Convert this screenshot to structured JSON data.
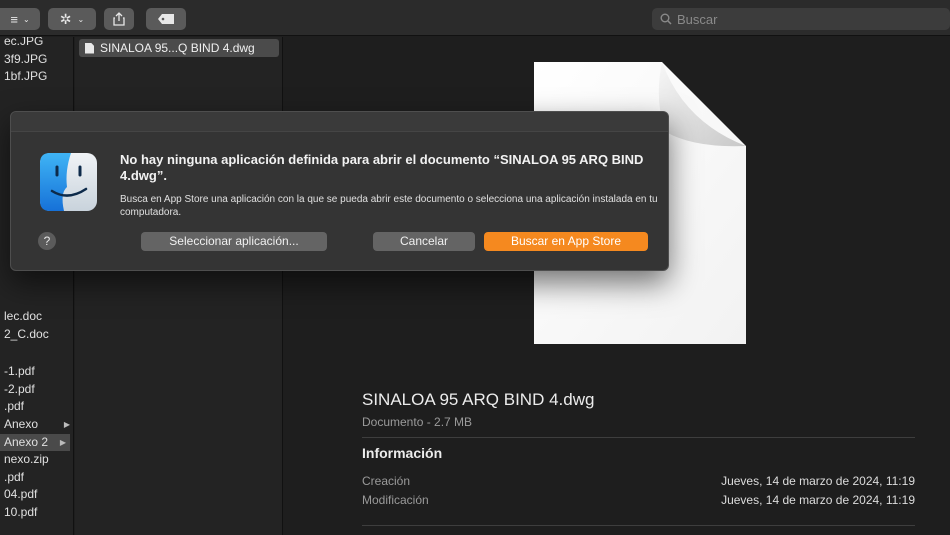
{
  "toolbar": {
    "view_icon": "list-view-icon",
    "action_icon": "gear-icon",
    "share_icon": "share-icon",
    "tag_icon": "tag-icon",
    "search_placeholder": "Buscar"
  },
  "column1": {
    "items": [
      {
        "label": "ec.JPG",
        "selected": false
      },
      {
        "label": "3f9.JPG",
        "selected": false
      },
      {
        "label": "1bf.JPG",
        "selected": false
      },
      {
        "label": "lec.doc",
        "selected": false
      },
      {
        "label": "2_C.doc",
        "selected": false
      },
      {
        "label": "-1.pdf",
        "selected": false
      },
      {
        "label": "-2.pdf",
        "selected": false
      },
      {
        "label": ".pdf",
        "selected": false
      },
      {
        "label": "Anexo",
        "selected": false,
        "folder": true
      },
      {
        "label": "Anexo 2",
        "selected": true,
        "folder": true
      },
      {
        "label": "nexo.zip",
        "selected": false
      },
      {
        "label": ".pdf",
        "selected": false
      },
      {
        "label": "04.pdf",
        "selected": false
      },
      {
        "label": "10.pdf",
        "selected": false
      }
    ]
  },
  "column2": {
    "selected_file": "SINALOA 95...Q BIND 4.dwg"
  },
  "preview": {
    "file_name": "SINALOA 95 ARQ BIND 4.dwg",
    "file_kind": "Documento - 2.7 MB",
    "info_heading": "Información",
    "rows": [
      {
        "label": "Creación",
        "value": "Jueves, 14 de marzo de 2024, 11:19"
      },
      {
        "label": "Modificación",
        "value": "Jueves, 14 de marzo de 2024, 11:19"
      }
    ]
  },
  "dialog": {
    "icon": "finder-icon",
    "title": "No hay ninguna aplicación definida para abrir el documento “SINALOA 95 ARQ BIND 4.dwg”.",
    "body": "Busca en App Store una aplicación con la que se pueda abrir este documento o selecciona una aplicación instalada en tu computadora.",
    "help_label": "?",
    "buttons": {
      "choose": "Seleccionar aplicación...",
      "cancel": "Cancelar",
      "store": "Buscar en App Store"
    },
    "accent_color": "#f5891f"
  }
}
